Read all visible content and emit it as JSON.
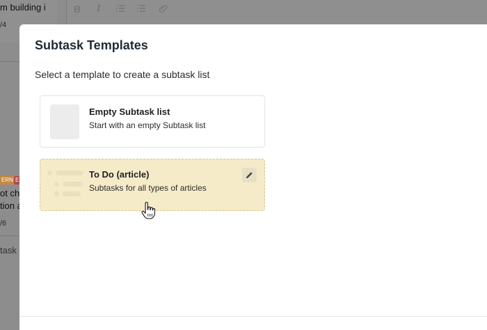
{
  "background": {
    "card_title": "m building i",
    "card_meta": "/4",
    "badges": [
      "ERN",
      "E"
    ],
    "snippet_lines": [
      "ot che",
      "tion a"
    ],
    "meta2": "/6",
    "add_task": "task",
    "editor_tools": [
      "bold-icon",
      "italic-icon",
      "bullet-list-icon",
      "numbered-list-icon",
      "attachment-icon"
    ]
  },
  "modal": {
    "title": "Subtask Templates",
    "subtitle": "Select a template to create a subtask list",
    "templates": [
      {
        "name": "Empty Subtask list",
        "description": "Start with an empty Subtask list",
        "thumbnail": "blank-thumbnail"
      },
      {
        "name": "To Do (article)",
        "description": "Subtasks for all types of articles",
        "thumbnail": "list-thumbnail",
        "action_icon": "pencil-icon"
      }
    ]
  },
  "colors": {
    "overlay": "#8c8c8c",
    "modal_bg": "#ffffff",
    "highlight_bg": "#f6ebc9",
    "highlight_border": "#d9c58f",
    "title": "#1f2a37"
  }
}
